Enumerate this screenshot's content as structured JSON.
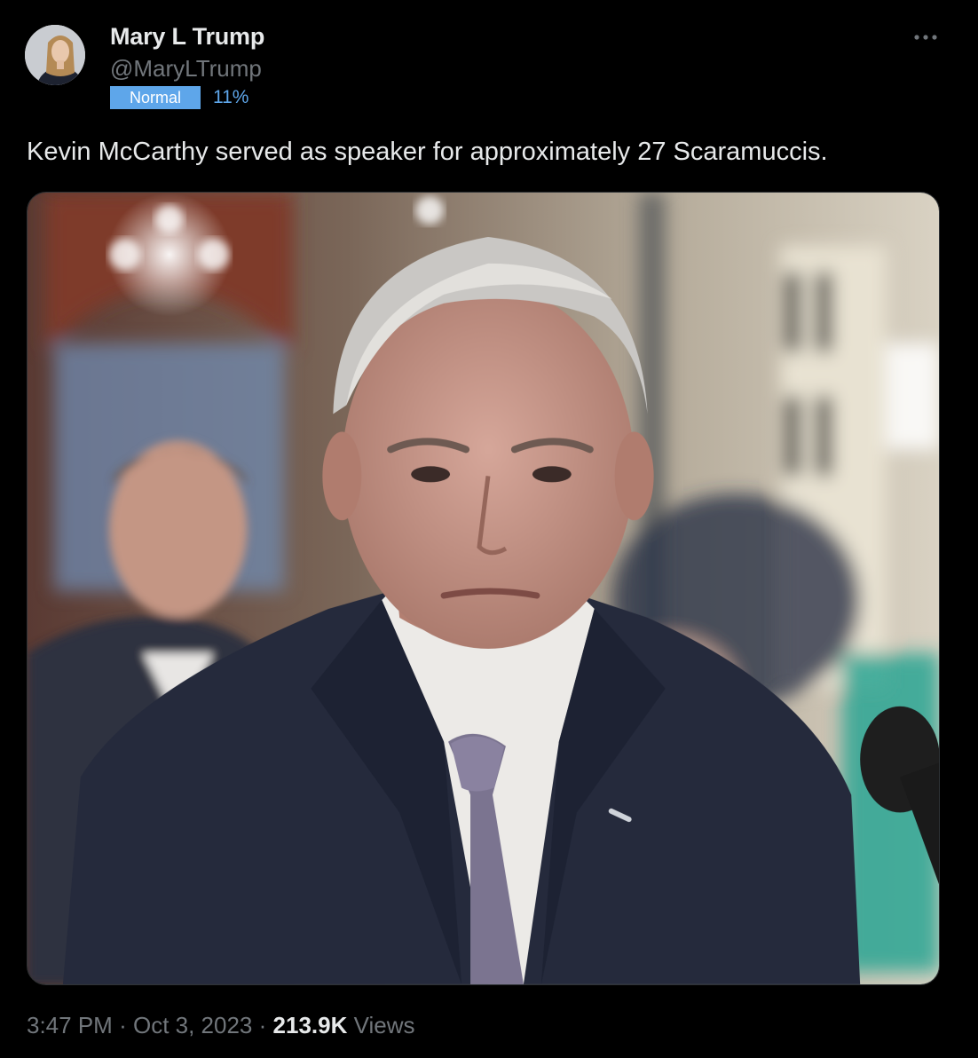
{
  "author": {
    "display_name": "Mary L Trump",
    "handle": "@MaryLTrump"
  },
  "badge": {
    "label": "Normal",
    "percent": "11%",
    "color": "#5ea6ea"
  },
  "menu": {
    "more_icon": "more-horizontal-icon"
  },
  "tweet": {
    "text": "Kevin McCarthy served as speaker for approximately 27 Scaramuccis."
  },
  "meta": {
    "time": "3:47 PM",
    "separator": "·",
    "date": "Oct 3, 2023",
    "views_count": "213.9K",
    "views_label": "Views"
  },
  "colors": {
    "background": "#000000",
    "primary_text": "#e7e9ea",
    "secondary_text": "#71767b",
    "accent": "#5ea6ea"
  }
}
